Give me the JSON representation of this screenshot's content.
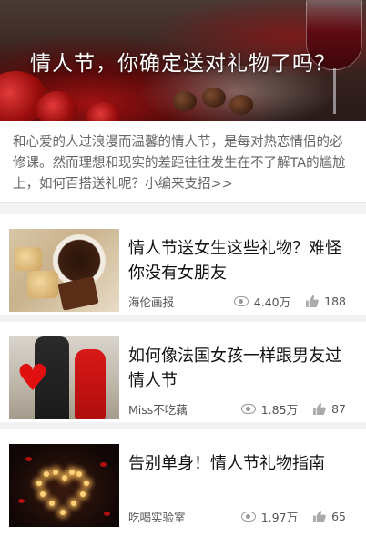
{
  "hero": {
    "title": "情人节，你确定送对礼物了吗？"
  },
  "intro": {
    "text": "和心爱的人过浪漫而温馨的情人节，是每对热恋情侣的必修课。然而理想和现实的差距往往发生在不了解TA的尴尬上，如何百搭送礼呢？小编来支招>>"
  },
  "articles": [
    {
      "title": "情人节送女生这些礼物？难怪你没有女朋友",
      "source": "海伦画报",
      "views": "4.40万",
      "likes": "188",
      "thumb_icon": "coffee-chocolate-thumbnail"
    },
    {
      "title": "如何像法国女孩一样跟男友过情人节",
      "source": "Miss不吃藕",
      "views": "1.85万",
      "likes": "87",
      "thumb_icon": "couple-heart-thumbnail"
    },
    {
      "title": "告别单身！情人节礼物指南",
      "source": "吃喝实验室",
      "views": "1.97万",
      "likes": "65",
      "thumb_icon": "candle-heart-thumbnail"
    }
  ],
  "icons": {
    "views": "eye-icon",
    "likes": "thumbs-up-icon"
  },
  "colors": {
    "hero_title": "#ffffff",
    "intro_text": "#666666",
    "meta_text": "#555555",
    "separator": "#f2f2f2"
  }
}
